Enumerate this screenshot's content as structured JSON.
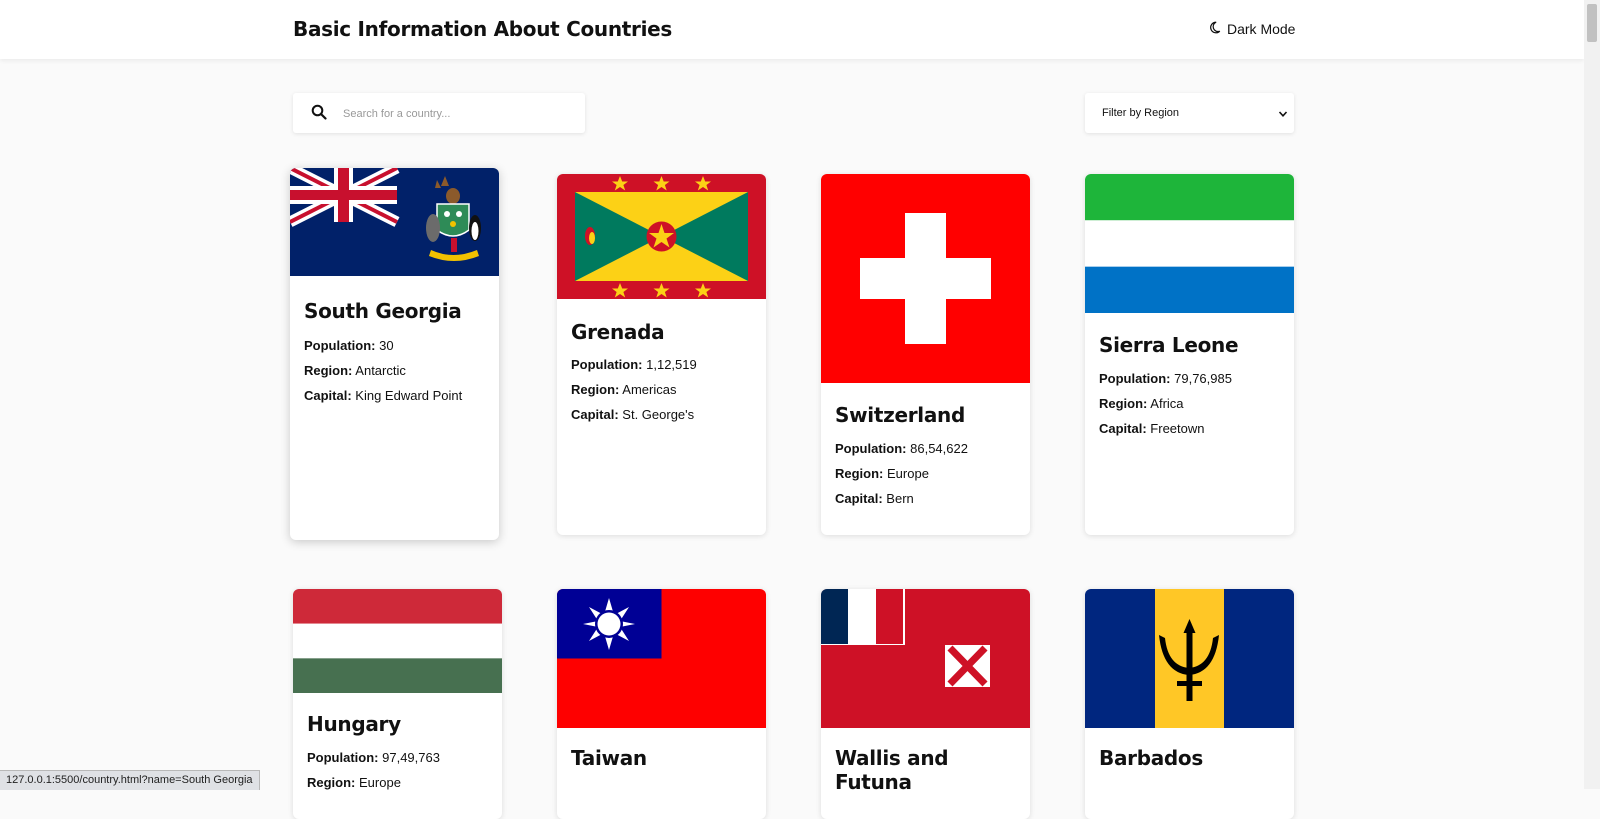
{
  "header": {
    "title": "Basic Information About Countries",
    "dark_mode_label": "Dark Mode"
  },
  "search": {
    "placeholder": "Search for a country..."
  },
  "filter": {
    "label": "Filter by Region"
  },
  "labels": {
    "population": "Population:",
    "region": "Region:",
    "capital": "Capital:"
  },
  "countries": [
    {
      "name": "South Georgia",
      "population": "30",
      "region": "Antarctic",
      "capital": "King Edward Point"
    },
    {
      "name": "Grenada",
      "population": "1,12,519",
      "region": "Americas",
      "capital": "St. George's"
    },
    {
      "name": "Switzerland",
      "population": "86,54,622",
      "region": "Europe",
      "capital": "Bern"
    },
    {
      "name": "Sierra Leone",
      "population": "79,76,985",
      "region": "Africa",
      "capital": "Freetown"
    },
    {
      "name": "Hungary",
      "population": "97,49,763",
      "region": "Europe"
    },
    {
      "name": "Taiwan"
    },
    {
      "name": "Wallis and Futuna"
    },
    {
      "name": "Barbados"
    }
  ],
  "status_url": "127.0.0.1:5500/country.html?name=South Georgia",
  "colors": {
    "background": "#fafafa",
    "card": "#ffffff",
    "text": "#111111"
  }
}
